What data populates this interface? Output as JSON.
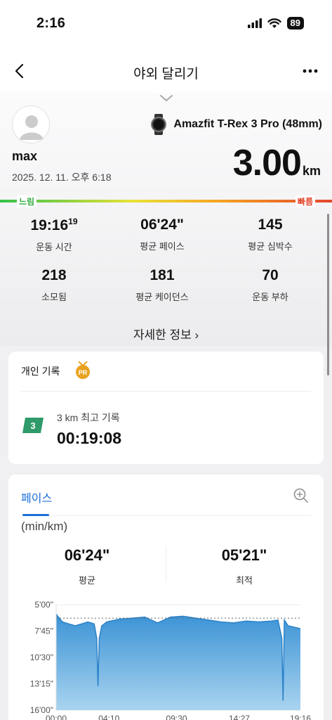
{
  "status_bar": {
    "time": "2:16",
    "battery": "89"
  },
  "nav": {
    "title": "야외 달리기"
  },
  "summary": {
    "device_name": "Amazfit T-Rex 3 Pro (48mm)",
    "user_name": "max",
    "date": "2025. 12. 11. 오후 6:18",
    "distance": "3.00",
    "distance_unit": "km",
    "scale_slow": "느림",
    "scale_fast": "빠름",
    "stats": [
      {
        "value": "19:16",
        "sup": "19",
        "label": "운동 시간"
      },
      {
        "value": "06'24\"",
        "label": "평균 페이스"
      },
      {
        "value": "145",
        "label": "평균 심박수"
      },
      {
        "value": "218",
        "label": "소모됨"
      },
      {
        "value": "181",
        "label": "평균 케이던스"
      },
      {
        "value": "70",
        "label": "운동 부하"
      }
    ],
    "details_link": "자세한 정보  ›"
  },
  "personal_record": {
    "title": "개인 기록",
    "badge": "PR",
    "distance_badge": "3",
    "name": "3 km 최고 기록",
    "value": "00:19:08"
  },
  "pace_chart": {
    "tab": "페이스",
    "unit": "(min/km)",
    "avg_value": "06'24\"",
    "avg_label": "평균",
    "best_value": "05'21\"",
    "best_label": "최적"
  },
  "colors": {
    "accent": "#1b6fd6",
    "chart_fill": "#4da2dc",
    "pr_green": "#2f9a6a",
    "pr_gold": "#e9a21f"
  },
  "chart_data": {
    "type": "area",
    "ylabel": "(min/km)",
    "y_ticks": [
      "5'00\"",
      "7'45\"",
      "10'30\"",
      "13'15\"",
      "16'00\""
    ],
    "ylim_min_per_km": [
      5.0,
      16.0
    ],
    "y_inverted": true,
    "x_ticks": [
      "00:00",
      "04:10",
      "09:30",
      "14:27",
      "19:16"
    ],
    "average_line": 6.4,
    "series": [
      {
        "x_minutes": [
          0,
          0.5,
          1,
          1.5,
          2,
          2.5,
          3,
          3.2,
          3.3,
          3.4,
          3.6,
          4,
          5,
          6,
          7,
          8,
          9,
          10,
          11,
          12,
          13,
          14,
          15,
          16,
          17,
          17.5,
          17.8,
          17.9,
          18,
          18.3,
          19.27
        ],
        "values": [
          6.0,
          6.8,
          7.0,
          7.2,
          7.0,
          6.8,
          7.0,
          8.5,
          13.5,
          8.5,
          7.2,
          6.8,
          6.5,
          6.4,
          6.3,
          6.9,
          6.3,
          6.2,
          6.4,
          6.6,
          6.8,
          6.9,
          6.7,
          6.8,
          6.7,
          6.6,
          8.5,
          15.0,
          6.6,
          7.2,
          7.5
        ]
      }
    ]
  }
}
